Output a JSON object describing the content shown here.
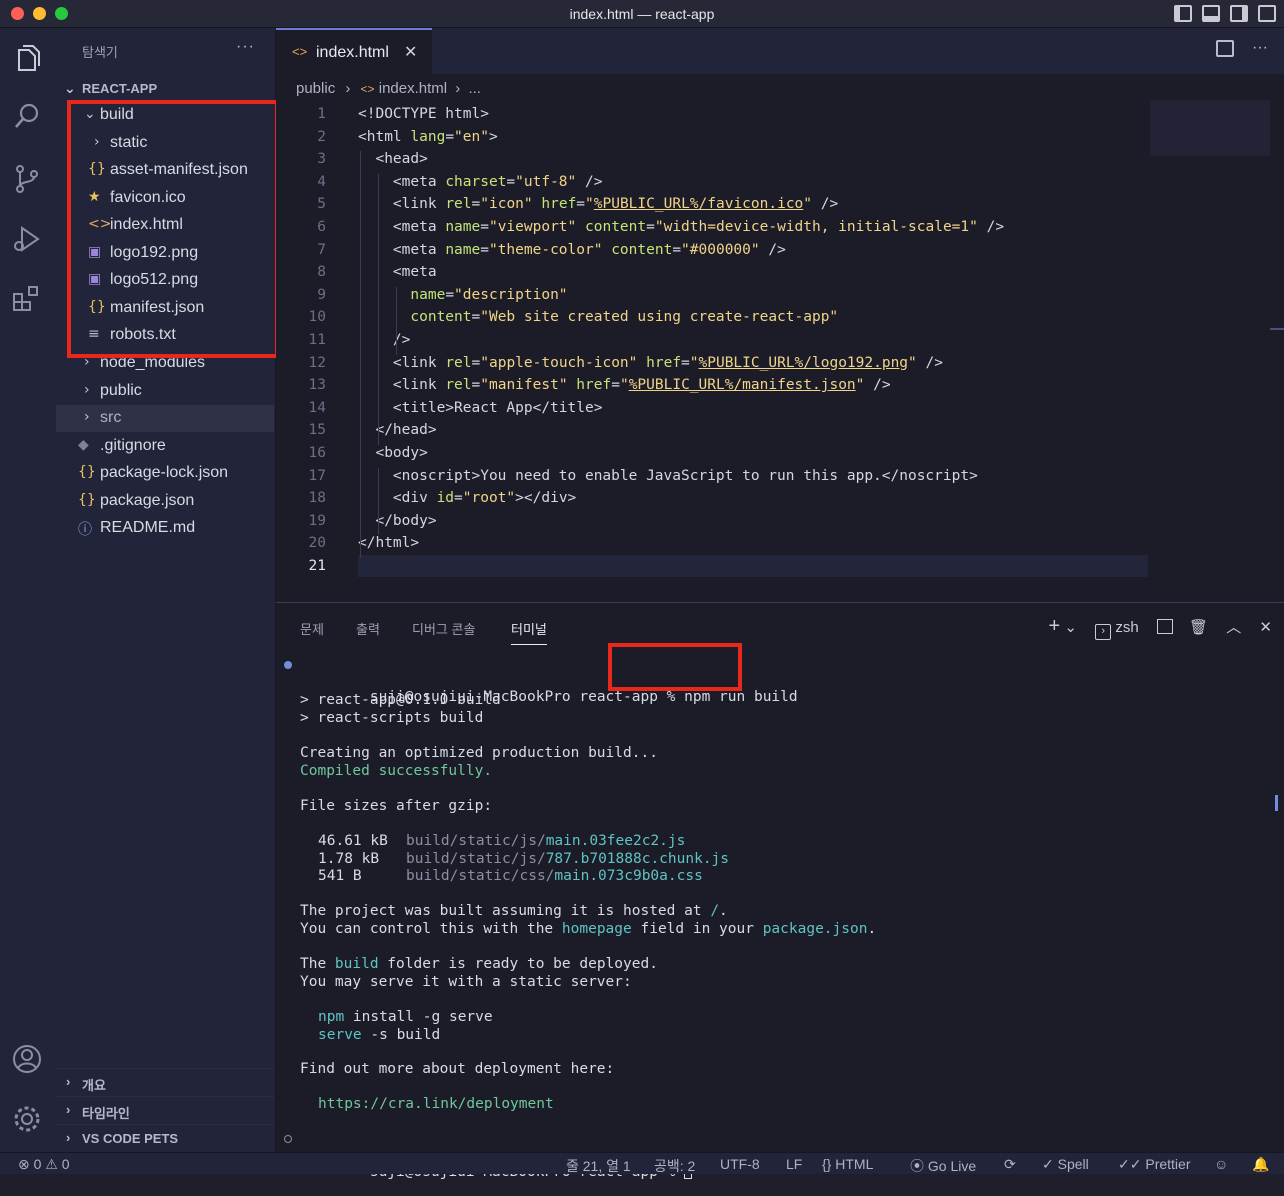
{
  "window": {
    "title": "index.html — react-app"
  },
  "explorer": {
    "title": "탐색기",
    "more": "···",
    "root": "REACT-APP",
    "items": [
      {
        "label": "build",
        "icon": "⌄"
      },
      {
        "label": "static",
        "icon": "›"
      },
      {
        "label": "asset-manifest.json",
        "icon": "{}"
      },
      {
        "label": "favicon.ico",
        "icon": "★"
      },
      {
        "label": "index.html",
        "icon": "<>"
      },
      {
        "label": "logo192.png",
        "icon": "▣"
      },
      {
        "label": "logo512.png",
        "icon": "▣"
      },
      {
        "label": "manifest.json",
        "icon": "{}"
      },
      {
        "label": "robots.txt",
        "icon": "≡"
      },
      {
        "label": "node_modules",
        "icon": "›"
      },
      {
        "label": "public",
        "icon": "›"
      },
      {
        "label": "src",
        "icon": "›"
      },
      {
        "label": ".gitignore",
        "icon": "◆"
      },
      {
        "label": "package-lock.json",
        "icon": "{}"
      },
      {
        "label": "package.json",
        "icon": "{}"
      },
      {
        "label": "README.md",
        "icon": "ⓘ"
      }
    ],
    "sections": [
      "개요",
      "타임라인",
      "VS CODE PETS"
    ]
  },
  "editor": {
    "tab_label": "index.html",
    "breadcrumb": [
      "public",
      "index.html",
      "..."
    ],
    "lines": [
      "<!DOCTYPE html>",
      "<html lang=\"en\">",
      "  <head>",
      "    <meta charset=\"utf-8\" />",
      "    <link rel=\"icon\" href=\"%PUBLIC_URL%/favicon.ico\" />",
      "    <meta name=\"viewport\" content=\"width=device-width, initial-scale=1\" />",
      "    <meta name=\"theme-color\" content=\"#000000\" />",
      "    <meta",
      "      name=\"description\"",
      "      content=\"Web site created using create-react-app\"",
      "    />",
      "    <link rel=\"apple-touch-icon\" href=\"%PUBLIC_URL%/logo192.png\" />",
      "    <link rel=\"manifest\" href=\"%PUBLIC_URL%/manifest.json\" />",
      "    <title>React App</title>",
      "  </head>",
      "  <body>",
      "    <noscript>You need to enable JavaScript to run this app.</noscript>",
      "    <div id=\"root\"></div>",
      "  </body>",
      "</html>",
      ""
    ]
  },
  "panel": {
    "tabs": [
      "문제",
      "출력",
      "디버그 콘솔",
      "터미널"
    ],
    "shell": "zsh",
    "terminal": {
      "prompt": "suji@osujiui-MacBookPro react-app % ",
      "command": "npm run build",
      "out1": "> react-app@0.1.0 build",
      "out2": "> react-scripts build",
      "creating": "Creating an optimized production build...",
      "compiled": "Compiled successfully.",
      "sizes_title": "File sizes after gzip:",
      "files": [
        {
          "size": "46.61 kB",
          "dir": "build/static/js/",
          "name": "main.03fee2c2.js"
        },
        {
          "size": "1.78 kB",
          "dir": "build/static/js/",
          "name": "787.b701888c.chunk.js"
        },
        {
          "size": "541 B",
          "dir": "build/static/css/",
          "name": "main.073c9b0a.css"
        }
      ],
      "hosted_a": "The project was built assuming it is hosted at ",
      "hosted_b": "/",
      "hosted_c": ".",
      "control_a": "You can control this with the ",
      "control_b": "homepage",
      "control_c": " field in your ",
      "control_d": "package.json",
      "control_e": ".",
      "ready_a": "The ",
      "ready_b": "build",
      "ready_c": " folder is ready to be deployed.",
      "serve_line": "You may serve it with a static server:",
      "npm_a": "npm",
      "npm_b": " install -g serve",
      "serve_cmd": "serve -s build",
      "findout": "Find out more about deployment here:",
      "link": "https://cra.link/deployment",
      "prompt2": "suji@osujiui-MacBookPro react-app % "
    }
  },
  "status": {
    "problems": "⊗ 0 ⚠ 0",
    "position": "줄 21, 열 1",
    "spaces": "공백: 2",
    "encoding": "UTF-8",
    "eol": "LF",
    "language": "{} HTML",
    "golive": "Go Live",
    "spell": "✓ Spell",
    "prettier": "✓✓ Prettier"
  },
  "colors": {
    "highlight": "#e8281c",
    "accent": "#6a7bd6"
  }
}
